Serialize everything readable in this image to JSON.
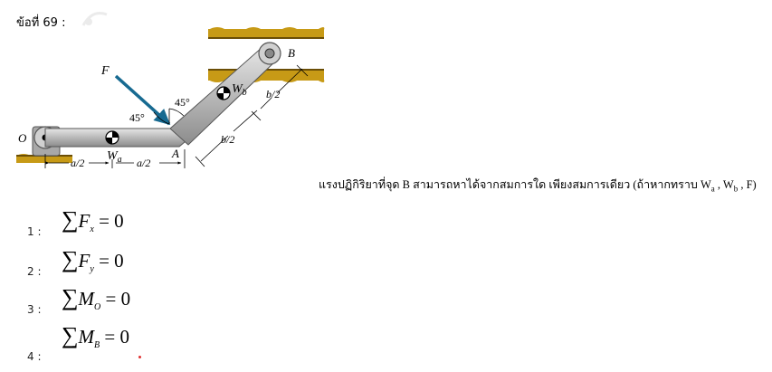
{
  "question_number": "ข้อที่ 69 :",
  "question_text": "แรงปฏิกิริยาที่จุด B สามารถหาได้จากสมการใด เพียงสมการเดียว (ถ้าหากทราบ W",
  "question_sub_a": "a",
  "question_sep1": " , W",
  "question_sub_b": "b",
  "question_end": " , F)",
  "figure": {
    "force_label": "F",
    "angle_left": "45°",
    "angle_right": "45°",
    "point_O": "O",
    "point_A": "A",
    "point_B": "B",
    "weight_a": "W",
    "weight_a_sub": "a",
    "weight_b": "W",
    "weight_b_sub": "b",
    "dim_a_left": "a/2",
    "dim_a_right": "a/2",
    "dim_b_lower": "b/2",
    "dim_b_upper": "b/2",
    "colors": {
      "bar": "#b9b9b9",
      "ground": "#c79a16",
      "force_arrow": "#176a91"
    }
  },
  "options": [
    {
      "number": "1 :",
      "symbol": "∑",
      "var": "F",
      "sub": "x",
      "rhs": "= 0"
    },
    {
      "number": "2 :",
      "symbol": "∑",
      "var": "F",
      "sub": "y",
      "rhs": "= 0"
    },
    {
      "number": "3 :",
      "symbol": "∑",
      "var": "M",
      "sub": "O",
      "rhs": "= 0"
    },
    {
      "number": "4 :",
      "symbol": "∑",
      "var": "M",
      "sub": "B",
      "rhs": "= 0"
    }
  ]
}
